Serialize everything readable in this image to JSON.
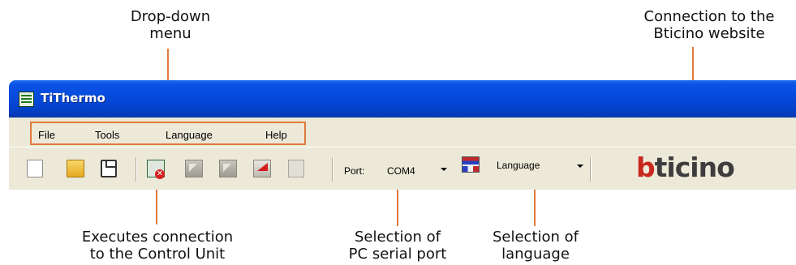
{
  "callouts": {
    "dropdown": [
      "Drop-down",
      "menu"
    ],
    "website": [
      "Connection to the",
      "Bticino website"
    ],
    "connect": [
      "Executes connection",
      "to the Control Unit"
    ],
    "serial": [
      "Selection of",
      "PC serial port"
    ],
    "language": [
      "Selection of",
      "language"
    ]
  },
  "window": {
    "title": "TiThermo",
    "menu": [
      "File",
      "Tools",
      "Language",
      "Help"
    ],
    "toolbar": {
      "port_label": "Port:",
      "port_value": "COM4",
      "language_label": "Language",
      "logo_b": "b",
      "logo_rest": "ticino"
    }
  },
  "colors": {
    "titlebar": "#0448d8",
    "chrome": "#ece9d8",
    "callout_line": "#e07a3a",
    "logo_red": "#c8281e",
    "logo_grey": "#3d3d3d"
  }
}
